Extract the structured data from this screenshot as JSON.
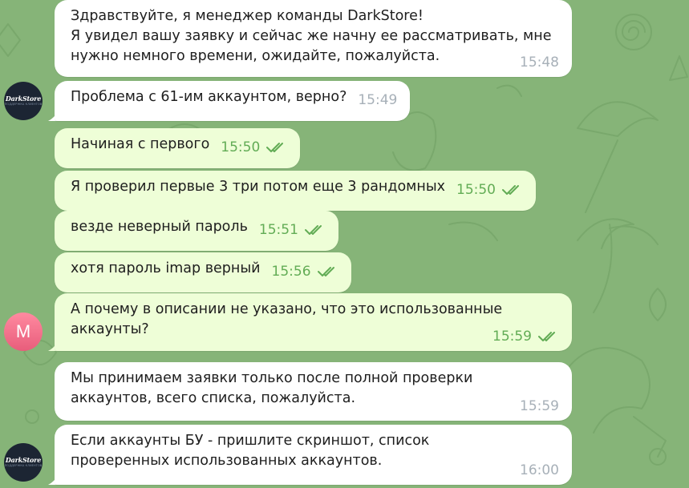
{
  "messages": [
    {
      "text": "Здравствуйте, я менеджер команды DarkStore!\nЯ увидел вашу заявку и сейчас же начну ее рассматривать, мне нужно немного времени, ожидайте, пожалуйста.",
      "time": "15:48",
      "direction": "in"
    },
    {
      "text": "Проблема с 61-им аккаунтом, верно?",
      "time": "15:49",
      "direction": "in"
    },
    {
      "text": "Начиная с первого",
      "time": "15:50",
      "direction": "out",
      "status": "read"
    },
    {
      "text": "Я проверил первые 3 три потом еще 3 рандомных",
      "time": "15:50",
      "direction": "out",
      "status": "read"
    },
    {
      "text": "везде неверный пароль",
      "time": "15:51",
      "direction": "out",
      "status": "read"
    },
    {
      "text": "хотя пароль imap верный",
      "time": "15:56",
      "direction": "out",
      "status": "read"
    },
    {
      "text": "А почему в описании не указано, что это использованные аккаунты?",
      "time": "15:59",
      "direction": "out",
      "status": "read"
    },
    {
      "text": "Мы принимаем заявки только после полной проверки аккаунтов, всего списка, пожалуйста.",
      "time": "15:59",
      "direction": "in"
    },
    {
      "text": "Если аккаунты БУ - пришлите скриншот, список проверенных использованных аккаунтов.",
      "time": "16:00",
      "direction": "in"
    }
  ],
  "avatars": {
    "manager": {
      "brand": "DarkStore",
      "tagline": "ПОДДЕРЖКА КЛИЕНТОВ",
      "icon": "darkstore-logo"
    },
    "user": {
      "letter": "M"
    }
  },
  "colors": {
    "background": "#86b478",
    "incoming_bubble": "#ffffff",
    "outgoing_bubble": "#eefed7",
    "outgoing_meta": "#62ac55",
    "incoming_meta": "#a7b0b8"
  }
}
